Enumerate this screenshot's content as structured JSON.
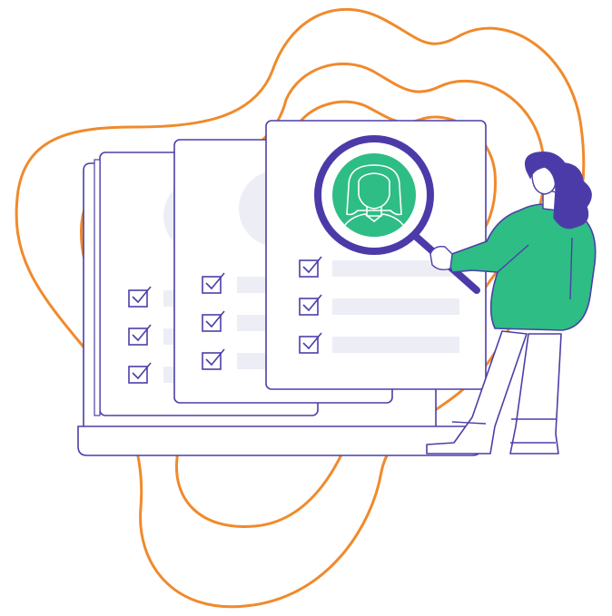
{
  "illustration": {
    "subject": "candidate-search",
    "colors": {
      "orange": "#F08A2C",
      "outline": "#4B3FA8",
      "purple": "#4B3BA8",
      "green": "#2EBD85",
      "placeholder": "#EDEEF5",
      "skin": "#FFFFFF",
      "background": "#FFFFFF"
    },
    "documents": [
      {
        "name": "back-document",
        "checklist_items": 3
      },
      {
        "name": "middle-document",
        "checklist_items": 3
      },
      {
        "name": "front-document",
        "checklist_items": 3
      }
    ],
    "icons": [
      "magnifying-glass-icon",
      "profile-avatar-icon",
      "checkbox-icon",
      "woman-figure"
    ]
  }
}
